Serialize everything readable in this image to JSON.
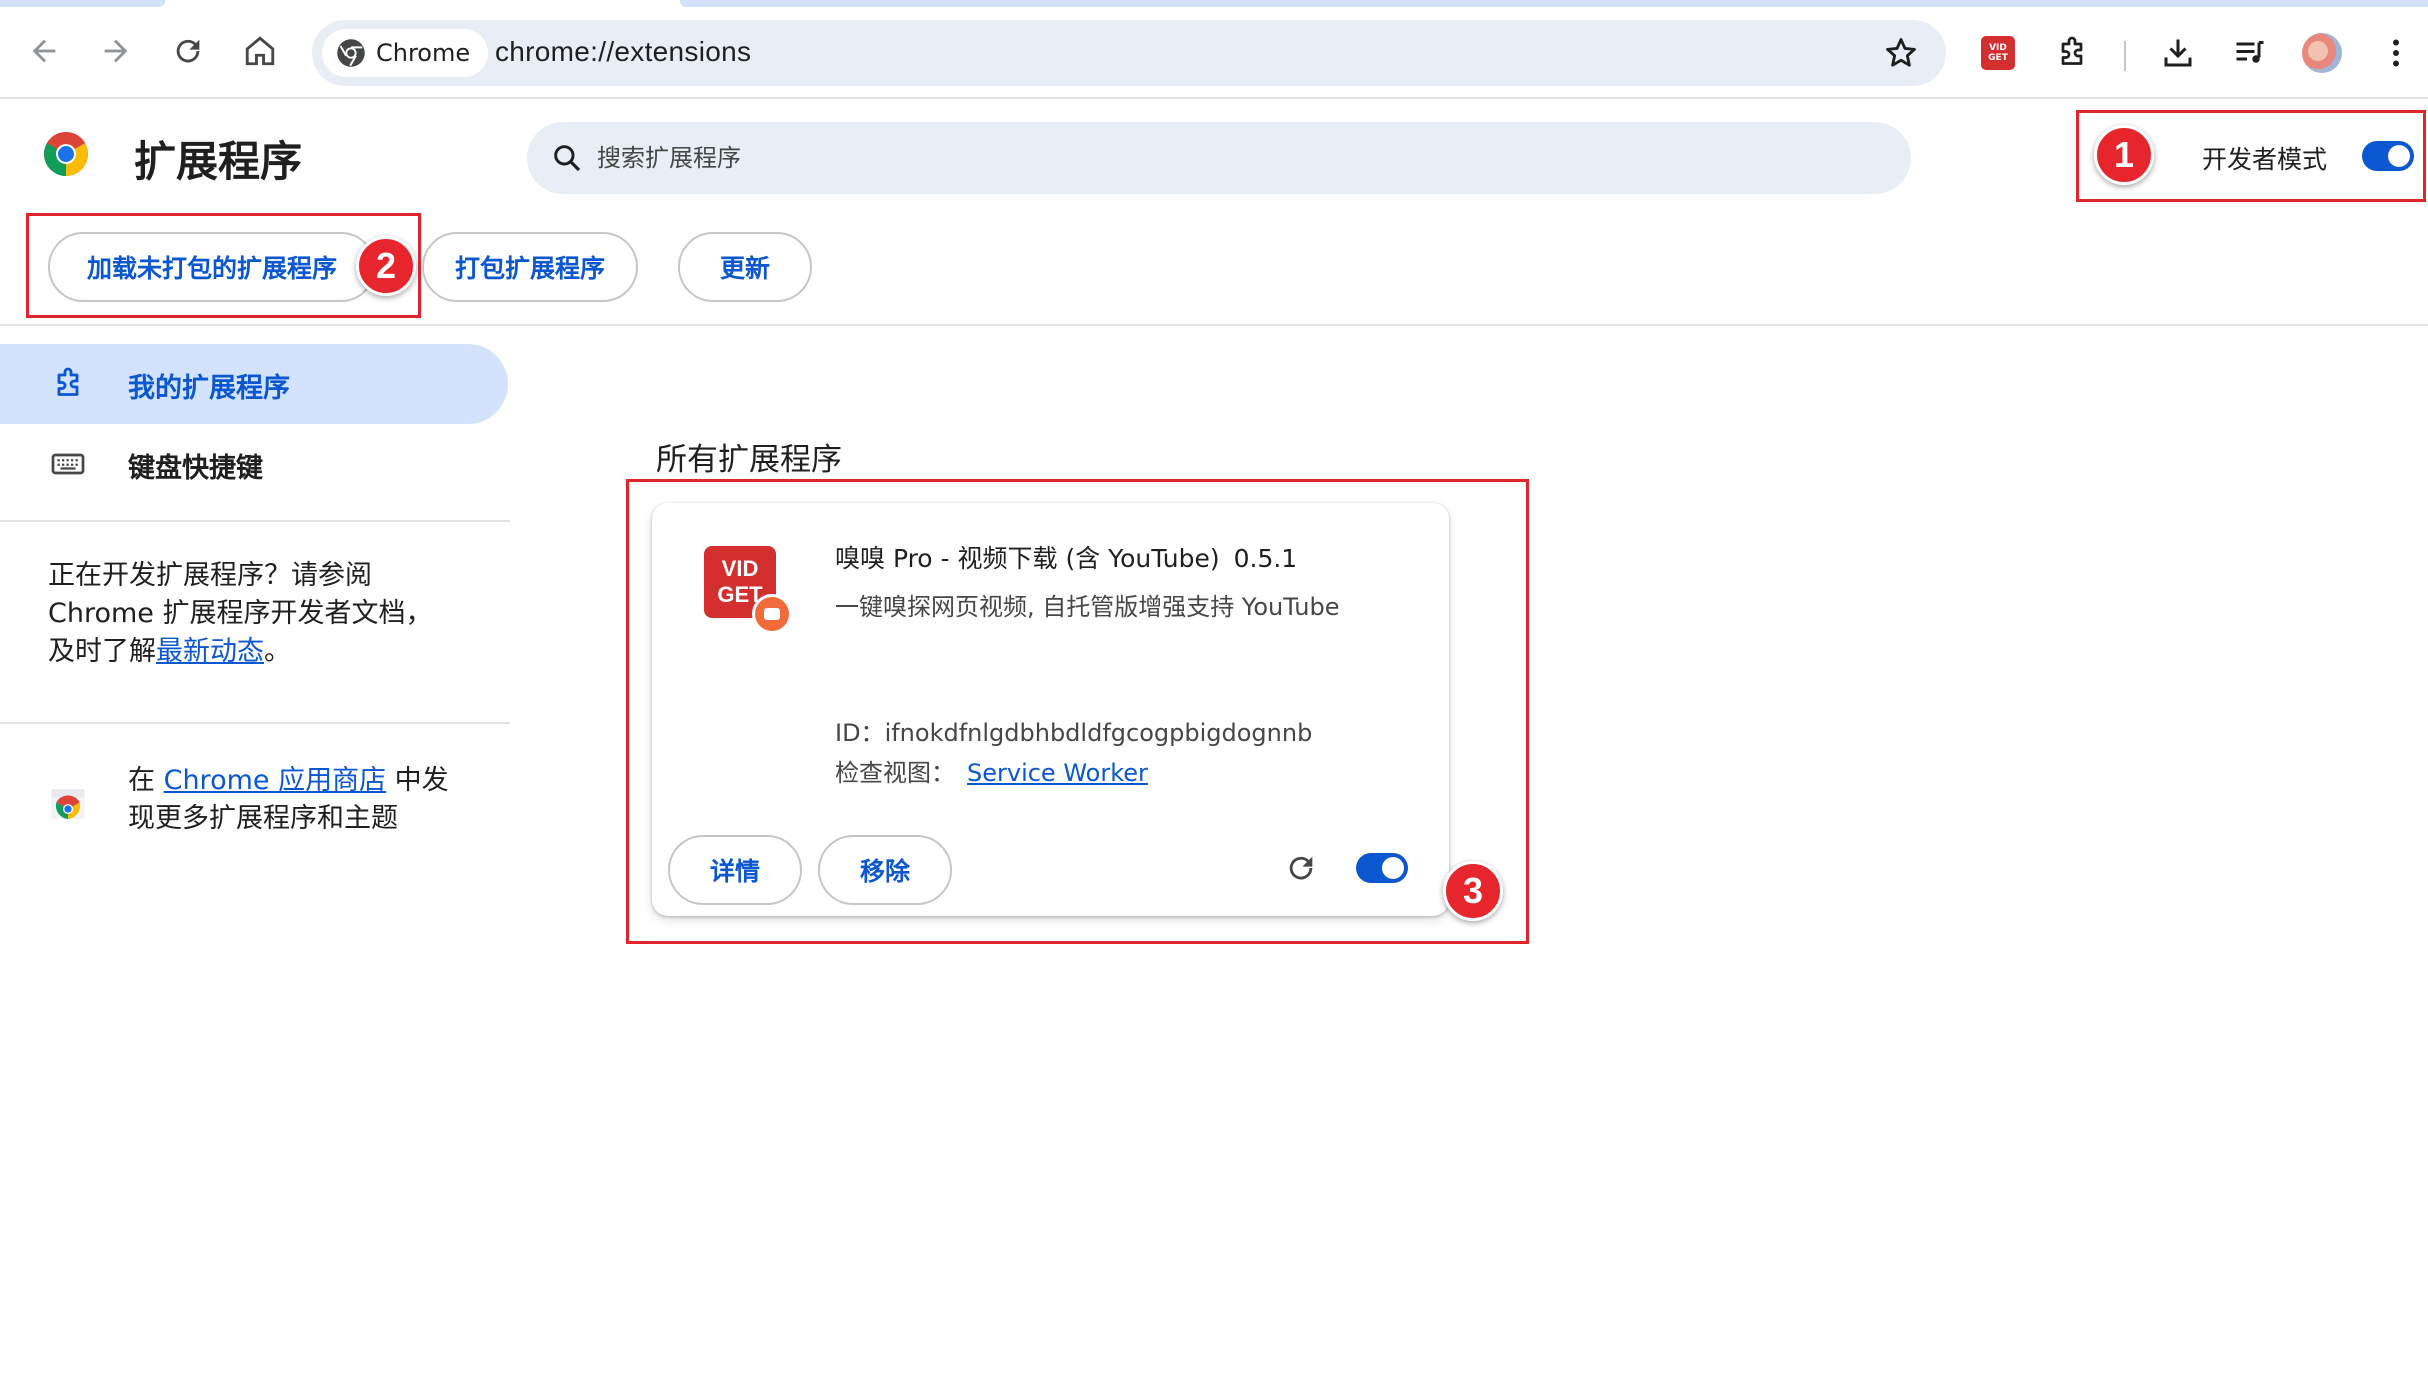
{
  "browser": {
    "chip_label": "Chrome",
    "url": "chrome://extensions"
  },
  "header": {
    "title": "扩展程序",
    "search_placeholder": "搜索扩展程序",
    "dev_mode_label": "开发者模式",
    "dev_mode_on": true
  },
  "actions": {
    "load_unpacked": "加载未打包的扩展程序",
    "pack": "打包扩展程序",
    "update": "更新"
  },
  "sidebar": {
    "items": [
      {
        "label": "我的扩展程序",
        "active": true
      },
      {
        "label": "键盘快捷键",
        "active": false
      }
    ],
    "dev_text_line1": "正在开发扩展程序？请参阅",
    "dev_text_line2": "Chrome 扩展程序开发者文档，",
    "dev_text_line3_prefix": "及时了解",
    "dev_text_link": "最新动态",
    "dev_text_suffix": "。",
    "store_prefix": "在 ",
    "store_link": "Chrome 应用商店",
    "store_suffix": " 中发",
    "store_line2": "现更多扩展程序和主题"
  },
  "main": {
    "section_title": "所有扩展程序",
    "extension": {
      "icon_text_1": "VID",
      "icon_text_2": "GET",
      "name": "嗅嗅 Pro - 视频下载 (含 YouTube)",
      "version": "0.5.1",
      "description": "一键嗅探网页视频, 自托管版增强支持 YouTube",
      "id_label": "ID：",
      "id_value": "ifnokdfnlgdbhbdldfgcogpbigdognnb",
      "views_label": "检查视图：",
      "views_link": "Service Worker",
      "details_button": "详情",
      "remove_button": "移除",
      "enabled": true
    }
  },
  "annotations": {
    "badge1": "1",
    "badge2": "2",
    "badge3": "3"
  },
  "colors": {
    "accent": "#0b57d0",
    "annotation_red": "#e0262b",
    "active_nav_bg": "#d3e3fd"
  }
}
